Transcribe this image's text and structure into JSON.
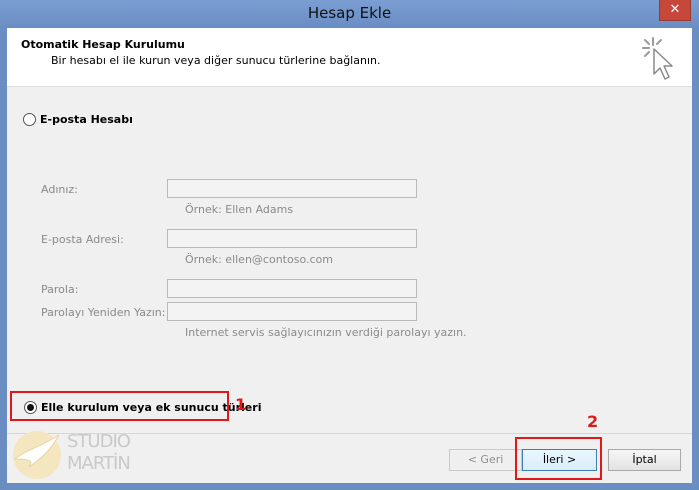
{
  "window": {
    "title": "Hesap Ekle",
    "close_glyph": "✕"
  },
  "header": {
    "title": "Otomatik Hesap Kurulumu",
    "subtitle": "Bir hesabı el ile kurun veya diğer sunucu türlerine bağlanın.",
    "icon": "cursor-click-icon"
  },
  "options": {
    "email_account": {
      "label": "E-posta Hesabı",
      "selected": false
    },
    "manual_setup": {
      "label": "Elle kurulum veya ek sunucu türleri",
      "selected": true
    }
  },
  "form": {
    "name": {
      "label": "Adınız:",
      "value": "",
      "hint": "Örnek: Ellen Adams"
    },
    "email": {
      "label": "E-posta Adresi:",
      "value": "",
      "hint": "Örnek: ellen@contoso.com"
    },
    "password": {
      "label": "Parola:",
      "value": ""
    },
    "password_confirm": {
      "label": "Parolayı Yeniden Yazın:",
      "value": ""
    },
    "password_hint": "Internet servis sağlayıcınızın verdiği parolayı yazın."
  },
  "annotations": {
    "step1": "1",
    "step2": "2",
    "color": "#e01818"
  },
  "buttons": {
    "back": "< Geri",
    "next": "İleri >",
    "cancel": "İptal"
  },
  "watermark": {
    "line1": "STUDIO",
    "line2": "MARTİN"
  }
}
